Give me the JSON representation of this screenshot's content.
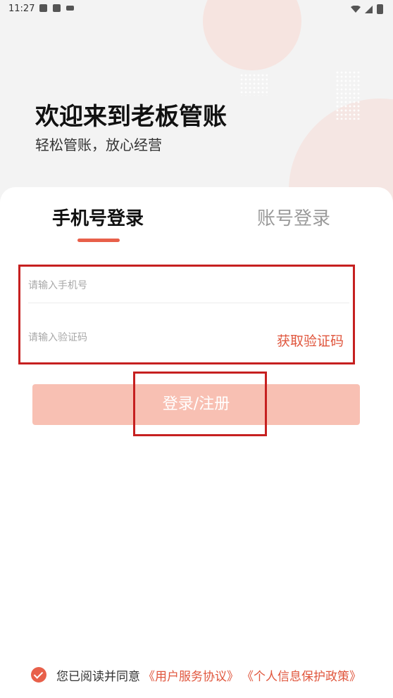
{
  "status_bar": {
    "time": "11:27"
  },
  "welcome": {
    "title": "欢迎来到老板管账",
    "subtitle": "轻松管账，放心经营"
  },
  "tabs": [
    {
      "label": "手机号登录",
      "active": true
    },
    {
      "label": "账号登录",
      "active": false
    }
  ],
  "form": {
    "phone_placeholder": "请输入手机号",
    "code_placeholder": "请输入验证码",
    "get_code_label": "获取验证码"
  },
  "login_button": {
    "label": "登录/注册"
  },
  "agreement": {
    "checked": true,
    "text": "您已阅读并同意",
    "link_user_agreement": "《用户服务协议》",
    "link_privacy": "《个人信息保护政策》"
  },
  "colors": {
    "accent": "#e8604a",
    "button_disabled": "#f8c0b3",
    "highlight_border": "#c62020"
  }
}
